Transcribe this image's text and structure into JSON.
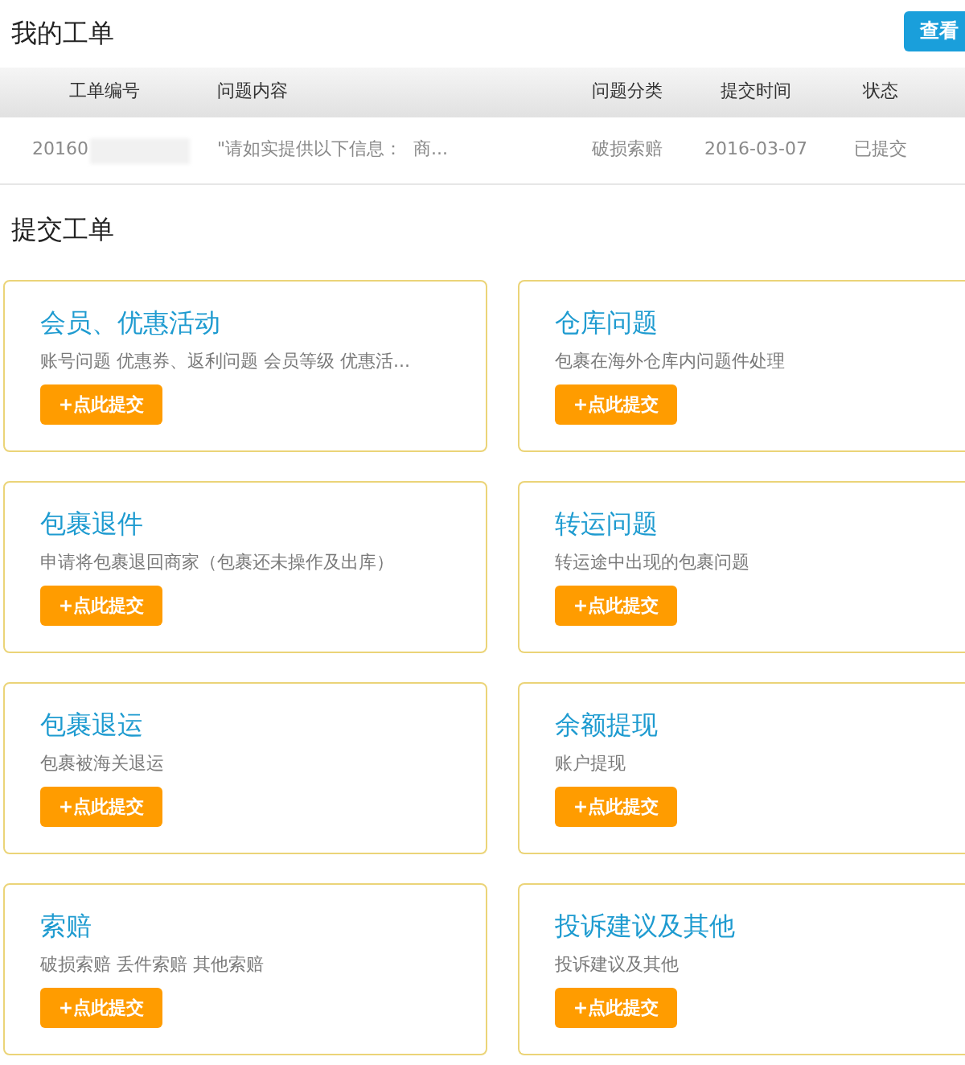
{
  "page_title": "我的工单",
  "view_all_button": "查看",
  "tickets_table": {
    "columns": [
      "工单编号",
      "问题内容",
      "问题分类",
      "提交时间",
      "状态"
    ],
    "rows": [
      {
        "ticket_number": "20160",
        "number_masked": true,
        "content": "\"请如实提供以下信息：  商...",
        "category": "破损索赔",
        "submitted": "2016-03-07",
        "status": "已提交"
      }
    ]
  },
  "submit_section": {
    "title": "提交工单",
    "categories": [
      {
        "title": "会员、优惠活动",
        "description": "账号问题 优惠券、返利问题 会员等级 优惠活...",
        "button": "+点此提交"
      },
      {
        "title": "仓库问题",
        "description": "包裹在海外仓库内问题件处理",
        "button": "+点此提交"
      },
      {
        "title": "包裹退件",
        "description": "申请将包裹退回商家（包裹还未操作及出库）",
        "button": "+点此提交"
      },
      {
        "title": "转运问题",
        "description": "转运途中出现的包裹问题",
        "button": "+点此提交"
      },
      {
        "title": "包裹退运",
        "description": "包裹被海关退运",
        "button": "+点此提交"
      },
      {
        "title": "余额提现",
        "description": "账户提现",
        "button": "+点此提交"
      },
      {
        "title": "索赔",
        "description": "破损索赔 丢件索赔 其他索赔",
        "button": "+点此提交"
      },
      {
        "title": "投诉建议及其他",
        "description": "投诉建议及其他",
        "button": "+点此提交"
      }
    ]
  }
}
